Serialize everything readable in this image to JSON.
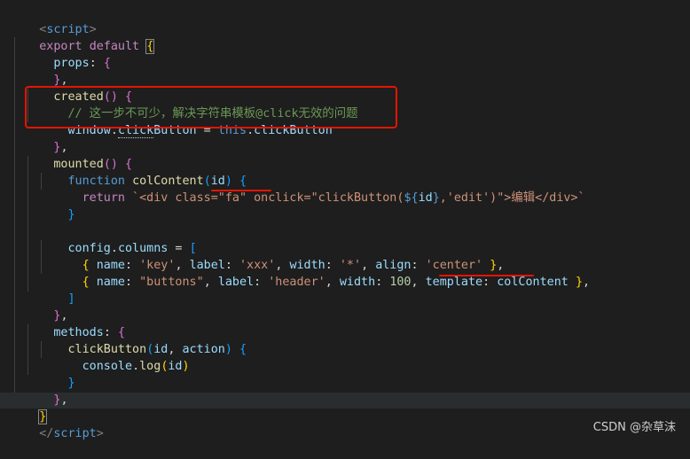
{
  "watermark": "CSDN @杂草沫",
  "colors": {
    "background": "#1e1e1e",
    "keyword": "#c586c0",
    "keyword_blue": "#569cd6",
    "property": "#9cdcfe",
    "function": "#dcdcaa",
    "string": "#ce9178",
    "number": "#b5cea8",
    "comment": "#6a9955",
    "highlight": "#e51400"
  },
  "code": {
    "l01": {
      "open": "<",
      "tag": "script",
      "close": ">"
    },
    "l02": {
      "export": "export",
      "default": "default",
      "brace": "{"
    },
    "l03": {
      "props": "props",
      "sep": ": ",
      "brace": "{"
    },
    "l04": {
      "close": "}",
      "comma": ","
    },
    "l05": {
      "name": "created",
      "parens": "()",
      "sp": " ",
      "brace": "{"
    },
    "l06": {
      "comment": "// 这一步不可少，解决字符串模板@click无效的问题"
    },
    "l07": {
      "window": "window",
      "dot1": ".",
      "click": "click",
      "button": "Button",
      "eq": " = ",
      "this": "this",
      "dot2": ".",
      "rhs": "clickButton"
    },
    "l08": {
      "close": "}",
      "comma": ","
    },
    "l09": {
      "name": "mounted",
      "parens": "()",
      "sp": " ",
      "brace": "{"
    },
    "l10": {
      "function": "function",
      "name": "colContent",
      "lp": "(",
      "arg": "id",
      "rp": ")",
      "sp": " ",
      "brace": "{"
    },
    "l11": {
      "return": "return",
      "s1": " `<div class=\"fa\" ",
      "s2": "onclick=\"clickButton(",
      "t_open": "${",
      "t_var": "id",
      "t_close": "}",
      "s3": ",'edit')\">编辑</div>`"
    },
    "l12": {
      "close": "}"
    },
    "l14": {
      "config": "config",
      "dot": ".",
      "columns": "columns",
      "eq": " = ",
      "bracket": "["
    },
    "l15": {
      "lb": "{",
      "k1": "name",
      "v1": "'key'",
      "k2": "label",
      "v2": "'xxx'",
      "k3": "width",
      "v3": "'*'",
      "k4": "align",
      "v4": "'center'",
      "rb": "}",
      "comma": ","
    },
    "l16": {
      "lb": "{",
      "k1": "name",
      "v1": "\"buttons\"",
      "k2": "label",
      "v2": "'header'",
      "k3": "width",
      "v3": "100",
      "k4": "template",
      "v4": "colContent",
      "rb": "}",
      "comma": ","
    },
    "l17": {
      "bracket": "]"
    },
    "l18": {
      "close": "}",
      "comma": ","
    },
    "l19": {
      "methods": "methods",
      "sep": ": ",
      "brace": "{"
    },
    "l20": {
      "name": "clickButton",
      "lp": "(",
      "a1": "id",
      "comma": ", ",
      "a2": "action",
      "rp": ")",
      "sp": " ",
      "brace": "{"
    },
    "l21": {
      "console": "console",
      "dot": ".",
      "log": "log",
      "lp": "(",
      "arg": "id",
      "rp": ")"
    },
    "l22": {
      "close": "}"
    },
    "l23": {
      "close": "}",
      "comma": ","
    },
    "l24": {
      "close": "}"
    },
    "l25": {
      "open": "</",
      "tag": "script",
      "close": ">"
    }
  }
}
